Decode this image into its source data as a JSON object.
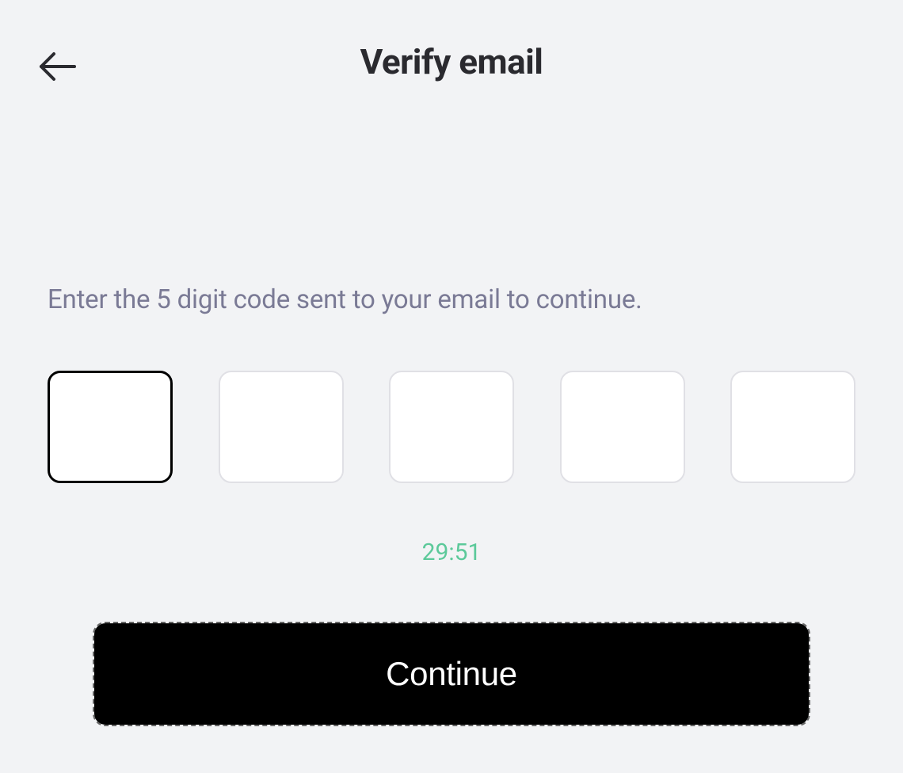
{
  "header": {
    "title": "Verify email"
  },
  "main": {
    "instruction": "Enter the 5 digit code sent to your email to continue.",
    "code_values": [
      "",
      "",
      "",
      "",
      ""
    ],
    "timer": "29:51",
    "continue_label": "Continue"
  }
}
